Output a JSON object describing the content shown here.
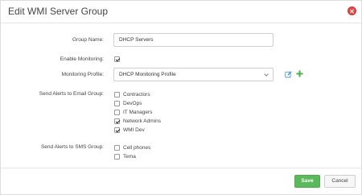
{
  "dialog": {
    "title": "Edit WMI Server Group"
  },
  "form": {
    "group_name_label": "Group Name:",
    "group_name_value": "DHCP Servers",
    "enable_monitoring_label": "Enable Monitoring:",
    "enable_monitoring_checked": true,
    "monitoring_profile_label": "Monitoring Profile:",
    "monitoring_profile_value": "DHCP Monitoring Profile",
    "email_group_label": "Send Alerts to Email Group:",
    "email_groups": [
      {
        "label": "Contractors",
        "checked": false
      },
      {
        "label": "DevOps",
        "checked": false
      },
      {
        "label": "IT Managers",
        "checked": false
      },
      {
        "label": "Network Admins",
        "checked": true
      },
      {
        "label": "WMI Dev",
        "checked": true
      }
    ],
    "sms_group_label": "Send Alerts to SMS Group:",
    "sms_groups": [
      {
        "label": "Cell phones",
        "checked": false
      },
      {
        "label": "Tema",
        "checked": false
      }
    ]
  },
  "footer": {
    "save_label": "Save",
    "cancel_label": "Cancel"
  },
  "colors": {
    "save": "#5cb85c",
    "close": "#e04a4a",
    "edit_icon": "#3a8fd0",
    "add_icon": "#4cae4c"
  }
}
